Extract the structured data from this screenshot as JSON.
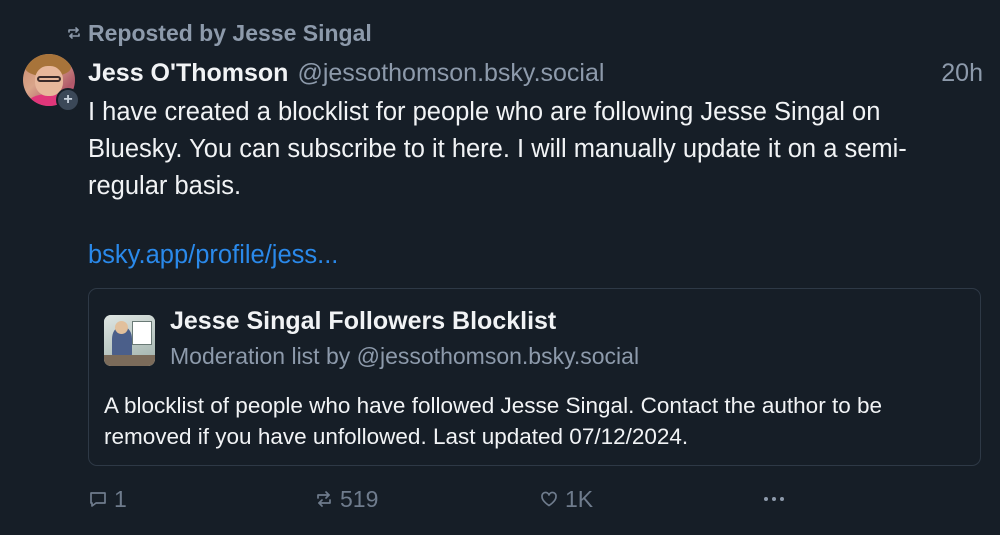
{
  "repost": {
    "label": "Reposted by Jesse Singal",
    "icon": "repost-icon"
  },
  "post": {
    "author_name": "Jess O'Thomson",
    "handle": "@jessothomson.bsky.social",
    "time": "20h",
    "text": "I have created a blocklist for people who are following Jesse Singal on Bluesky. You can subscribe to it here. I will manually update it on a semi-regular basis.",
    "link": "bsky.app/profile/jess..."
  },
  "embed": {
    "title": "Jesse Singal Followers Blocklist",
    "subtitle": "Moderation list by @jessothomson.bsky.social",
    "description": "A blocklist of people who have followed Jesse Singal. Contact the author to be removed if you have unfollowed. Last updated 07/12/2024."
  },
  "actions": {
    "replies": "1",
    "reposts": "519",
    "likes": "1K"
  },
  "colors": {
    "background": "#161e27",
    "link": "#2a89ea",
    "muted": "#8d9aab"
  }
}
